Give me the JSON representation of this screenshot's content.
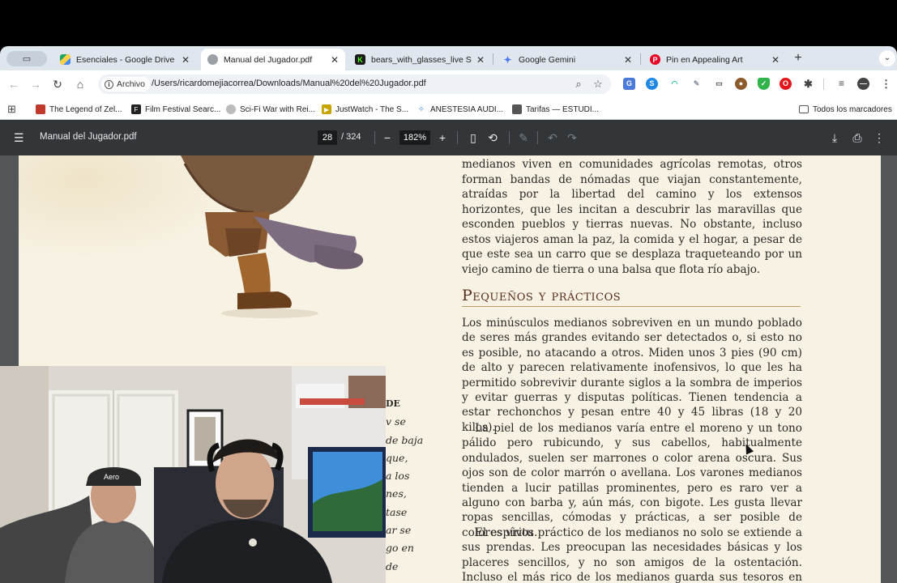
{
  "tabs": [
    {
      "title": "Esenciales - Google Drive",
      "icon": "google-drive-icon",
      "active": false
    },
    {
      "title": "Manual del Jugador.pdf",
      "icon": "globe-icon",
      "active": true
    },
    {
      "title": "bears_with_glasses_live Stre",
      "icon": "kick-icon",
      "active": false
    },
    {
      "title": "Google Gemini",
      "icon": "gemini-icon",
      "active": false
    },
    {
      "title": "Pin en Appealing Art",
      "icon": "pinterest-icon",
      "active": false
    }
  ],
  "toolbar": {
    "chip_label": "Archivo",
    "url": "/Users/ricardomejiacorrea/Downloads/Manual%20del%20Jugador.pdf"
  },
  "bookmarks": [
    {
      "label": "The Legend of Zel...",
      "icon": "zelda-icon",
      "color": "#c0392b"
    },
    {
      "label": "Film Festival Searc...",
      "icon": "filmfreeway-icon",
      "color": "#222222"
    },
    {
      "label": "Sci-Fi War with Rei...",
      "icon": "site-icon",
      "color": "#999999"
    },
    {
      "label": "JustWatch - The S...",
      "icon": "justwatch-icon",
      "color": "#c8a400"
    },
    {
      "label": "ANESTESIA AUDI...",
      "icon": "anestesia-icon",
      "color": "#4a90d9"
    },
    {
      "label": "Tarifas — ESTUDI...",
      "icon": "notion-icon",
      "color": "#333333"
    }
  ],
  "all_bookmarks_label": "Todos los marcadores",
  "pdf": {
    "title": "Manual del Jugador.pdf",
    "page": "28",
    "total": "/ 324",
    "zoom": "182%"
  },
  "content": {
    "top_paragraph": "medianos viven en comunidades agrícolas remotas, otros forman bandas de nómadas que viajan constantemente, atraídas por la libertad del camino y los extensos horizontes, que les incitan a descubrir las maravillas que esconden pueblos y tierras nuevas. No obstante, incluso estos viajeros aman la paz, la comida y el hogar, a pesar de que este sea un carro que se desplaza traqueteando por un viejo camino de tierra o una balsa que flota río abajo.",
    "heading": "Pequeños y prácticos",
    "p1": "Los minúsculos medianos sobreviven en un mundo poblado de seres más grandes evitando ser detectados o, si esto no es posible, no atacando a otros. Miden unos 3 pies (90 cm) de alto y parecen relativamente inofensivos, lo que les ha permitido sobrevivir durante siglos a la sombra de imperios y evitar guerras y disputas políticas. Tienen tendencia a estar rechonchos y pesan entre 40 y 45 libras (18 y 20 kilos).",
    "p2": "La piel de los medianos varía entre el moreno y un tono pálido pero rubicundo, y sus cabellos, habitualmente ondulados, suelen ser marrones o color arena oscura. Sus ojos son de color marrón o avellana. Los varones medianos tienden a lucir patillas prominentes, pero es raro ver a alguno con barba y, aún más, con bigote. Les gusta llevar ropas sencillas, cómodas y prácticas, a ser posible de colores vivos.",
    "p3": "El espíritu práctico de los medianos no solo se extiende a sus prendas. Les preocupan las necesidades básicas y los placeres sencillos, y no son amigos de la ostentación. Incluso el más rico de los medianos guarda sus tesoros en un sótano bajo",
    "left_fragments": [
      "DE",
      "v se",
      "de baja",
      "que,",
      "a los",
      "nes,",
      "tase",
      "ar se",
      "go en",
      "de"
    ]
  },
  "colors": {
    "page_bg": "#f7f2e4",
    "pdf_toolbar": "#323639",
    "heading": "#5a2d1a",
    "chrome_frame": "#dfe6ee"
  }
}
